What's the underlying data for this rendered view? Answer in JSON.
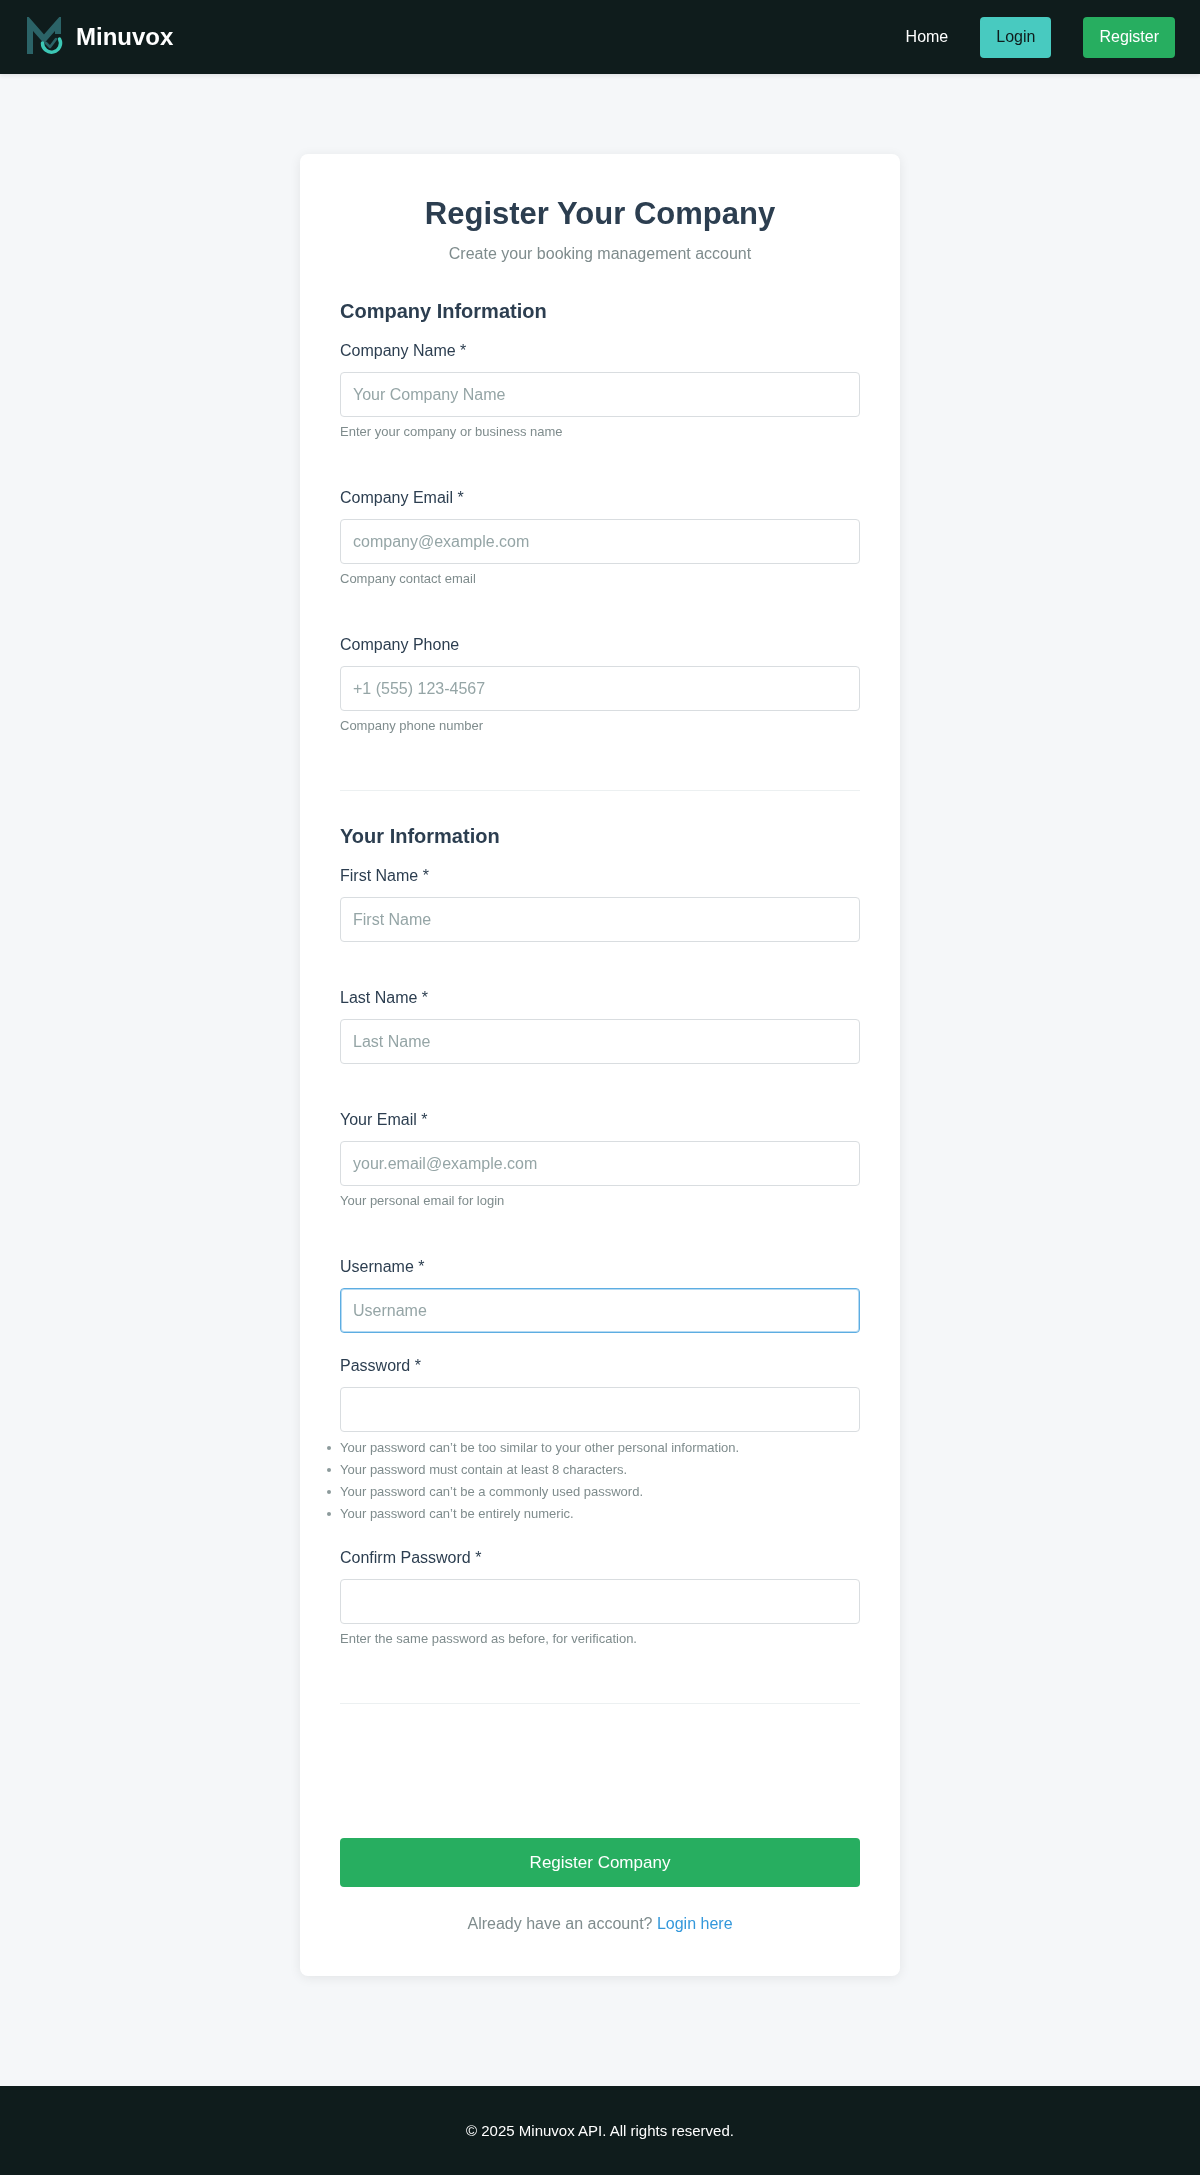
{
  "header": {
    "brand": "Minuvox",
    "nav": [
      {
        "label": "Home",
        "kind": "link"
      },
      {
        "label": "Login",
        "kind": "accent"
      },
      {
        "label": "Register",
        "kind": "primary"
      }
    ]
  },
  "form": {
    "title": "Register Your Company",
    "subtitle": "Create your booking management account",
    "sections": [
      {
        "heading": "Company Information",
        "fields": [
          {
            "label": "Company Name *",
            "placeholder": "Your Company Name",
            "help": "Enter your company or business name",
            "focused": false
          },
          {
            "label": "Company Email *",
            "placeholder": "company@example.com",
            "help": "Company contact email",
            "focused": false
          },
          {
            "label": "Company Phone",
            "placeholder": "+1 (555) 123-4567",
            "help": "Company phone number",
            "focused": false
          }
        ]
      },
      {
        "heading": "Your Information",
        "fields": [
          {
            "label": "First Name *",
            "placeholder": "First Name",
            "focused": false
          },
          {
            "label": "Last Name *",
            "placeholder": "Last Name",
            "focused": false
          },
          {
            "label": "Your Email *",
            "placeholder": "your.email@example.com",
            "help": "Your personal email for login",
            "focused": false
          },
          {
            "label": "Username *",
            "placeholder": "Username",
            "focused": true
          },
          {
            "label": "Password *",
            "focused": false,
            "hints": [
              "Your password can’t be too similar to your other personal information.",
              "Your password must contain at least 8 characters.",
              "Your password can’t be a commonly used password.",
              "Your password can’t be entirely numeric."
            ]
          },
          {
            "label": "Confirm Password *",
            "help": "Enter the same password as before, for verification.",
            "focused": false
          }
        ]
      }
    ],
    "submit": "Register Company",
    "login_prompt": {
      "text": "Already have an account?",
      "link": "Login here"
    }
  },
  "footer": {
    "text": "© 2025 Minuvox API. All rights reserved."
  }
}
